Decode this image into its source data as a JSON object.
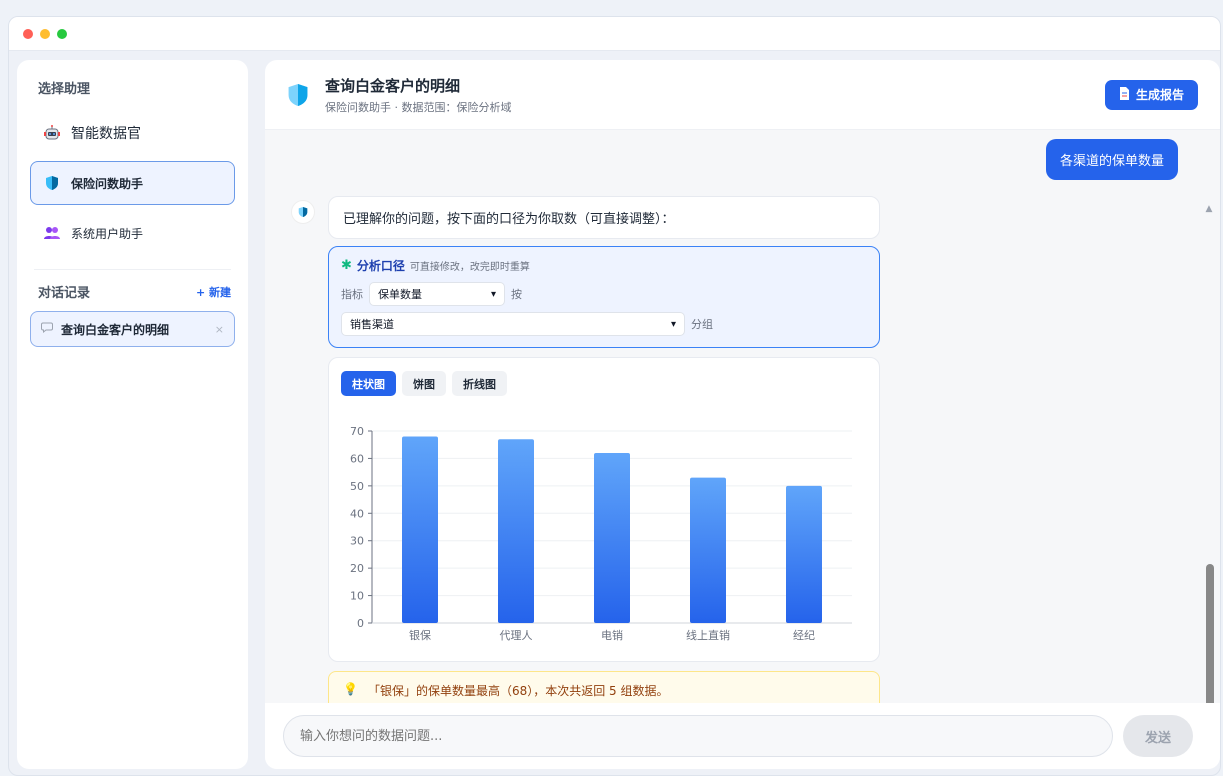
{
  "window": {
    "dot_colors": [
      "#ff5f56",
      "#ffbd2e",
      "#27c93f"
    ]
  },
  "sidebar": {
    "section_title": "选择助理",
    "assistants": [
      {
        "label": "智能数据官",
        "icon": "robot-icon"
      },
      {
        "label": "保险问数助手",
        "icon": "shield-icon"
      },
      {
        "label": "系统用户助手",
        "icon": "users-icon"
      }
    ],
    "history_title": "对话记录",
    "new_label": "+ 新建",
    "history": [
      {
        "label": "查询白金客户的明细",
        "icon": "chat-bubble-icon",
        "close": "×"
      }
    ]
  },
  "header": {
    "title": "查询白金客户的明细",
    "subtitle": "保险问数助手 · 数据范围：保险分析域",
    "report_button": "生成报告"
  },
  "chat": {
    "user_message": "各渠道的保单数量",
    "bot_message": "已理解你的问题，按下面的口径为你取数（可直接调整）：",
    "caliber": {
      "title": "分析口径",
      "desc": "可直接修改，改完即时重算",
      "metric_label": "指标",
      "metric_value": "保单数量",
      "by_label": "按",
      "group_value": "销售渠道",
      "group_label": "分组"
    },
    "chart_tabs": [
      "柱状图",
      "饼图",
      "折线图"
    ],
    "insight": "「银保」的保单数量最高（68），本次共返回 5 组数据。"
  },
  "input": {
    "placeholder": "输入你想问的数据问题...",
    "send_label": "发送"
  },
  "chart_data": {
    "type": "bar",
    "categories": [
      "银保",
      "代理人",
      "电销",
      "线上直销",
      "经纪"
    ],
    "values": [
      68,
      67,
      62,
      53,
      50
    ],
    "ylim": [
      0,
      70
    ],
    "yticks": [
      0,
      10,
      20,
      30,
      40,
      50,
      60,
      70
    ],
    "bar_color_top": "#60a5fa",
    "bar_color_bottom": "#2563eb"
  }
}
